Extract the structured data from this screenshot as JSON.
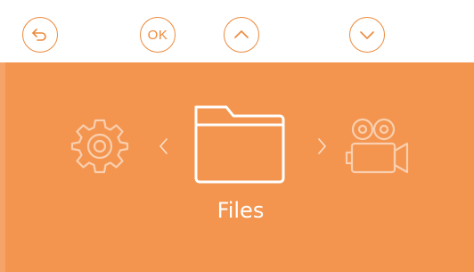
{
  "toolbar": {
    "ok_label": "OK",
    "buttons": [
      {
        "name": "back",
        "icon": "back-arrow-icon"
      },
      {
        "name": "ok",
        "icon": "ok-icon"
      },
      {
        "name": "up",
        "icon": "chevron-up-icon"
      },
      {
        "name": "down",
        "icon": "chevron-down-icon"
      }
    ]
  },
  "carousel": {
    "selected_label": "Files",
    "items": [
      {
        "icon": "gear-icon"
      },
      {
        "icon": "folder-icon"
      },
      {
        "icon": "video-camera-icon"
      }
    ]
  },
  "colors": {
    "accent": "#ec8a3d",
    "background": "#f3954f",
    "toolbar_bg": "#ffffff",
    "foreground": "#ffffff"
  }
}
